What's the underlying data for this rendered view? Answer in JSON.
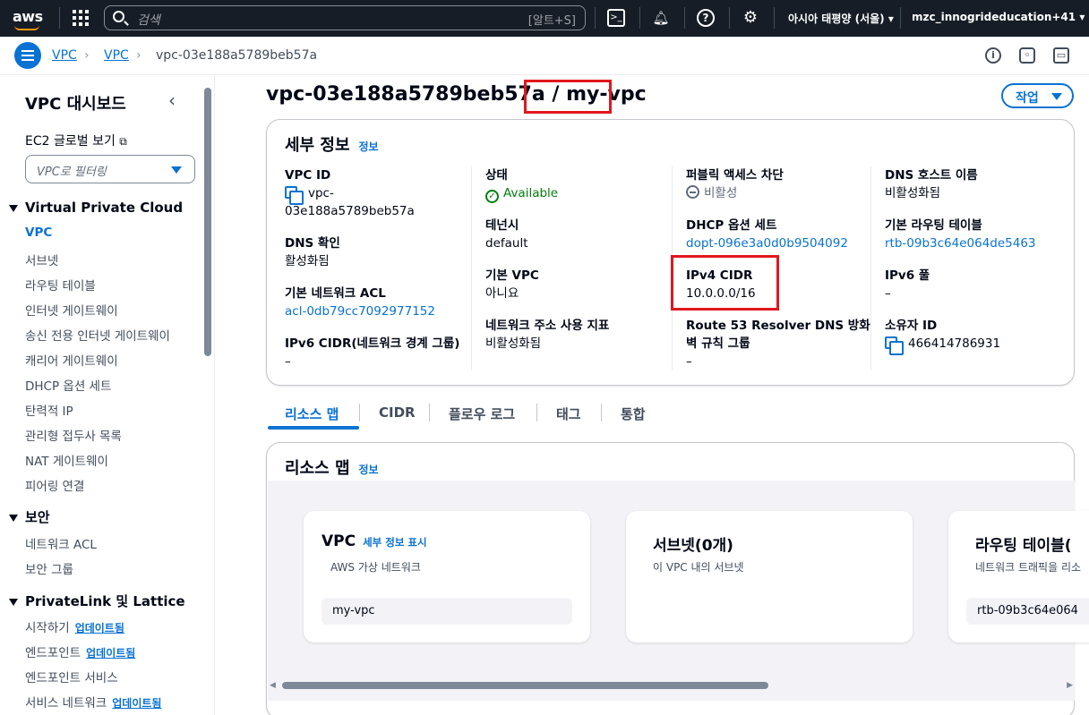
{
  "topnav": {
    "logo": "aws",
    "search_placeholder": "검색",
    "search_shortcut": "[알트+S]",
    "region": "아시아 태평양 (서울)",
    "account": "mzc_innogrideducation+41"
  },
  "breadcrumb": {
    "items": [
      "VPC",
      "VPC"
    ],
    "current": "vpc-03e188a5789beb57a"
  },
  "sidebar": {
    "title": "VPC 대시보드",
    "ec2_global": "EC2 글로벌 보기",
    "filter_placeholder": "VPC로 필터링",
    "section_vpc": "Virtual Private Cloud",
    "vpc_items": [
      "VPC",
      "서브넷",
      "라우팅 테이블",
      "인터넷 게이트웨이",
      "송신 전용 인터넷 게이트웨이",
      "캐리어 게이트웨이",
      "DHCP 옵션 세트",
      "탄력적 IP",
      "관리형 접두사 목록",
      "NAT 게이트웨이",
      "피어링 연결"
    ],
    "section_security": "보안",
    "security_items": [
      "네트워크 ACL",
      "보안 그룹"
    ],
    "section_privatelink": "PrivateLink 및 Lattice",
    "privatelink_items": [
      "시작하기",
      "엔드포인트",
      "엔드포인트 서비스",
      "서비스 네트워크"
    ],
    "badge": "업데이트됨"
  },
  "page": {
    "title_id": "vpc-03e188a5789beb57a",
    "title_sep": "/",
    "title_name": "my-vpc",
    "actions_label": "작업"
  },
  "details": {
    "header": "세부 정보",
    "info": "정보",
    "col1": {
      "vpc_id_label": "VPC ID",
      "vpc_id_line1": "vpc-",
      "vpc_id_line2": "03e188a5789beb57a",
      "dns_resolution_label": "DNS 확인",
      "dns_resolution_value": "활성화됨",
      "default_acl_label": "기본 네트워크 ACL",
      "default_acl_value": "acl-0db79cc7092977152",
      "ipv6_cidr_label": "IPv6 CIDR(네트워크 경계 그룹)",
      "ipv6_cidr_value": "–"
    },
    "col2": {
      "state_label": "상태",
      "state_value": "Available",
      "tenancy_label": "테넌시",
      "tenancy_value": "default",
      "default_vpc_label": "기본 VPC",
      "default_vpc_value": "아니요",
      "usage_label": "네트워크 주소 사용 지표",
      "usage_value": "비활성화됨"
    },
    "col3": {
      "block_label": "퍼블릭 액세스 차단",
      "block_value": "비활성",
      "dhcp_label": "DHCP 옵션 세트",
      "dhcp_value": "dopt-096e3a0d0b9504092",
      "ipv4_label": "IPv4 CIDR",
      "ipv4_value": "10.0.0.0/16",
      "route53_label_1": "Route 53 Resolver DNS 방화",
      "route53_label_2": "벽 규칙 그룹",
      "route53_value": "–"
    },
    "col4": {
      "dns_host_label": "DNS 호스트 이름",
      "dns_host_value": "비활성화됨",
      "main_rt_label": "기본 라우팅 테이블",
      "main_rt_value": "rtb-09b3c64e064de5463",
      "ipv6_pool_label": "IPv6 풀",
      "ipv6_pool_value": "–",
      "owner_label": "소유자 ID",
      "owner_value": "466414786931"
    }
  },
  "tabs": [
    "리소스 맵",
    "CIDR",
    "플로우 로그",
    "태그",
    "통합"
  ],
  "resource_map": {
    "header": "리소스 맵",
    "info": "정보",
    "vpc": {
      "title": "VPC",
      "link": "세부 정보 표시",
      "sub": "AWS 가상 네트워크",
      "pill": "my-vpc"
    },
    "subnets": {
      "title": "서브넷(0개)",
      "sub": "이 VPC 내의 서브넷"
    },
    "routes": {
      "title": "라우팅 테이블(",
      "sub": "네트워크 트래픽을 리소",
      "pill": "rtb-09b3c64e064"
    }
  },
  "colors": {
    "accent": "#0972d3",
    "nav": "#161d26",
    "highlight": "#e1171e",
    "success": "#037f0c"
  }
}
